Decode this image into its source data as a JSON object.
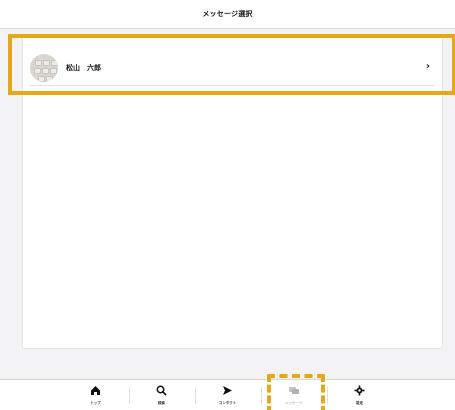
{
  "header": {
    "title": "メッセージ選択"
  },
  "list": [
    {
      "name": "松山　六郎"
    }
  ],
  "tabs": [
    {
      "label": "トップ",
      "icon": "home-icon"
    },
    {
      "label": "検索",
      "icon": "search-icon"
    },
    {
      "label": "コンタクト",
      "icon": "send-icon"
    },
    {
      "label": "メッセージ",
      "icon": "message-icon"
    },
    {
      "label": "設定",
      "icon": "gear-icon"
    }
  ],
  "active_tab": "メッセージ",
  "colors": {
    "highlight": "#e5a917",
    "inactive_tab": "#b8b8c0"
  }
}
